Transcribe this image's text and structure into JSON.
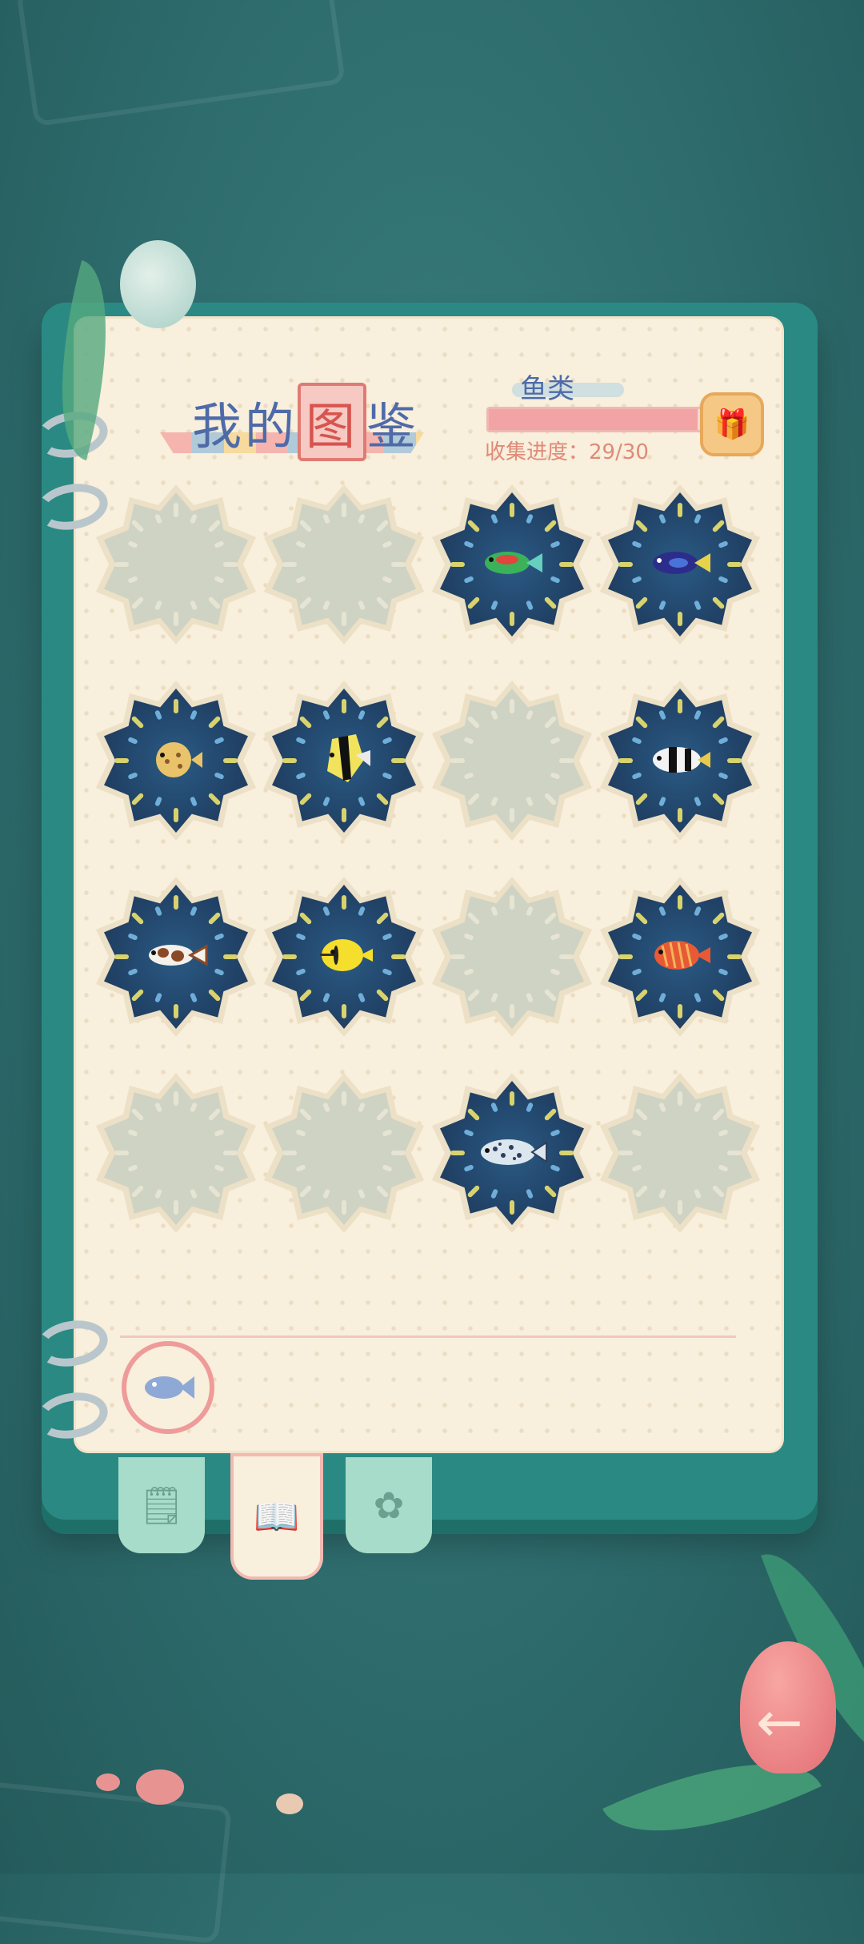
{
  "title": {
    "part1": "我的",
    "highlight": "图",
    "part2": "鉴"
  },
  "category": "鱼类",
  "progress": {
    "label": "收集进度：29/30",
    "collected": 29,
    "total": 30
  },
  "slots": [
    {
      "unlocked": false,
      "fish": ""
    },
    {
      "unlocked": false,
      "fish": ""
    },
    {
      "unlocked": true,
      "fish": "green-parrotfish"
    },
    {
      "unlocked": true,
      "fish": "blue-tang"
    },
    {
      "unlocked": true,
      "fish": "pufferfish"
    },
    {
      "unlocked": true,
      "fish": "moorish-idol"
    },
    {
      "unlocked": false,
      "fish": ""
    },
    {
      "unlocked": true,
      "fish": "striped-bannerfish"
    },
    {
      "unlocked": true,
      "fish": "clown-sweetlips"
    },
    {
      "unlocked": true,
      "fish": "yellow-butterflyfish"
    },
    {
      "unlocked": false,
      "fish": ""
    },
    {
      "unlocked": true,
      "fish": "red-striped-fish"
    },
    {
      "unlocked": false,
      "fish": ""
    },
    {
      "unlocked": false,
      "fish": ""
    },
    {
      "unlocked": true,
      "fish": "spotted-grouper"
    },
    {
      "unlocked": false,
      "fish": ""
    }
  ],
  "tabs": [
    {
      "icon": "photo-card-icon",
      "active": false
    },
    {
      "icon": "book-star-icon",
      "active": true
    },
    {
      "icon": "flower-icon",
      "active": false
    }
  ],
  "colors": {
    "accent": "#4e6aa8",
    "highlight": "#d7544f",
    "progress": "#f2a3a3",
    "unlocked": "#203f63",
    "locked": "#cfd3c4"
  }
}
